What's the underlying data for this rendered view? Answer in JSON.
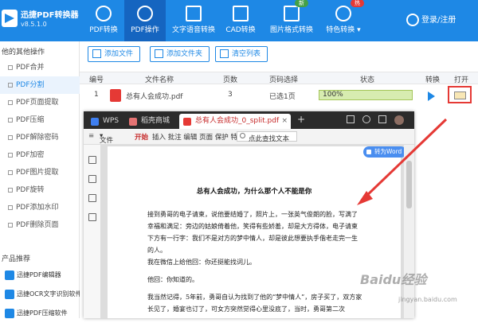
{
  "app": {
    "title": "迅捷PDF转换器",
    "version": "v8.5.1.0",
    "login": "登录/注册"
  },
  "nav": [
    {
      "label": "PDF转换",
      "icon": "swap-icon"
    },
    {
      "label": "PDF操作",
      "icon": "gear-icon"
    },
    {
      "label": "文字语音转换",
      "icon": "audio-icon"
    },
    {
      "label": "CAD转换",
      "icon": "cad-icon"
    },
    {
      "label": "图片格式转换",
      "icon": "image-icon",
      "badge": "新",
      "badge_color": "#43a047"
    },
    {
      "label": "特色转换",
      "icon": "star-icon",
      "badge": "热",
      "badge_color": "#e53935"
    }
  ],
  "sidebar": {
    "section1": "他的其他操作",
    "items": [
      "PDF合并",
      "PDF分割",
      "PDF页面提取",
      "PDF压缩",
      "PDF解除密码",
      "PDF加密",
      "PDF图片提取",
      "PDF旋转",
      "PDF添加水印",
      "PDF删除页面"
    ],
    "section2": "产品推荐",
    "products": [
      "迅捷PDF编辑器",
      "迅捷OCR文字识别软件",
      "迅捷PDF压缩软件"
    ]
  },
  "toolbar": {
    "add_file": "添加文件",
    "add_folder": "添加文件夹",
    "clear": "清空列表"
  },
  "table": {
    "headers": [
      "编号",
      "文件名称",
      "页数",
      "页码选择",
      "状态",
      "转换",
      "打开"
    ],
    "rows": [
      {
        "no": "1",
        "name": "总有人会成功.pdf",
        "pages": "3",
        "selection": "已选1页",
        "progress": "100%",
        "progress_value": 1.0
      }
    ]
  },
  "wps": {
    "tabs": [
      "WPS",
      "稻壳商城",
      "总有人会成功_0_split.pdf"
    ],
    "menu_file": "文件",
    "menu_start": "开始",
    "menu_items": "插入 批注 编辑 页面 保护 特",
    "search": "点此查找文本",
    "to_word": "转为Word",
    "doc_title": "总有人会成功，为什么那个人不能是你",
    "paragraphs": [
      "接到勇哥的电子请柬，说他要结婚了，照片上，一张英气俊朗的脸，写满了幸福和满足：旁边的姑娘倚着他，笑得有些娇羞，却是大方得体，电子请柬下方有一行字：我们不是对方的梦中情人，却是彼此想要执手偕老走完一生的人。",
      "我在微信上给他回：你还挺能找词儿。",
      "他回：你知道的。",
      "我当然记得，5年前，勇哥自认为找到了他的“梦中情人”，房子买了，双方家长见了，婚宴也订了，可女方突然觉得心里没底了，当时，勇哥第二次"
    ]
  },
  "watermark": {
    "brand": "Baidu经验",
    "url": "jingyan.baidu.com"
  }
}
